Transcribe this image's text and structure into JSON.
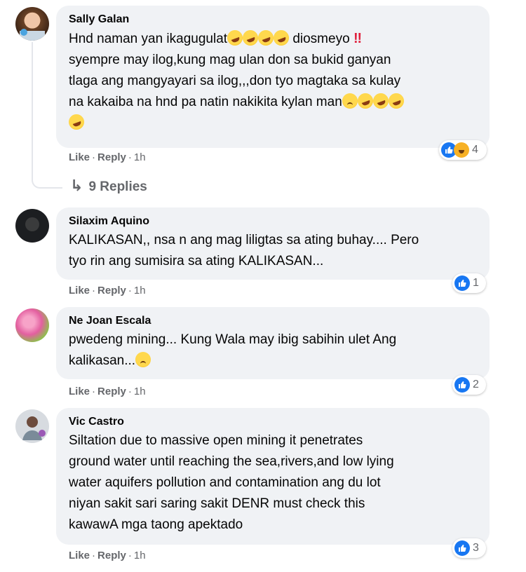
{
  "comments": [
    {
      "author": "Sally Galan",
      "lines": [
        "Hnd naman yan ikagugulat",
        "diosmeyo",
        "syempre may ilog,kung mag ulan don sa bukid ganyan",
        "tlaga ang mangyayari sa ilog,,,don tyo magtaka sa kulay",
        "na kakaiba na hnd pa natin nakikita kylan man"
      ],
      "like": "Like",
      "reply": "Reply",
      "time": "1h",
      "reactions": "4",
      "view_replies": "9 Replies"
    },
    {
      "author": "Silaxim Aquino",
      "lines": [
        "KALIKASAN,, nsa n ang mag liligtas sa ating buhay.... Pero",
        "tyo rin ang sumisira sa ating KALIKASAN..."
      ],
      "like": "Like",
      "reply": "Reply",
      "time": "1h",
      "reactions": "1"
    },
    {
      "author": "Ne Joan Escala",
      "lines": [
        "pwedeng mining... Kung Wala may ibig sabihin ulet Ang",
        "kalikasan..."
      ],
      "like": "Like",
      "reply": "Reply",
      "time": "1h",
      "reactions": "2"
    },
    {
      "author": "Vic Castro",
      "lines": [
        "Siltation due to massive open mining it penetrates",
        "ground water until reaching the sea,rivers,and low lying",
        "water aquifers pollution and contamination ang du lot",
        "niyan sakit sari saring sakit DENR must check this",
        "kawawA mga taong apektado"
      ],
      "like": "Like",
      "reply": "Reply",
      "time": "1h",
      "reactions": "3"
    }
  ],
  "icons": {
    "like_color": "#1877f2",
    "bubble_color": "#f0f2f5",
    "meta_color": "#65676b"
  }
}
